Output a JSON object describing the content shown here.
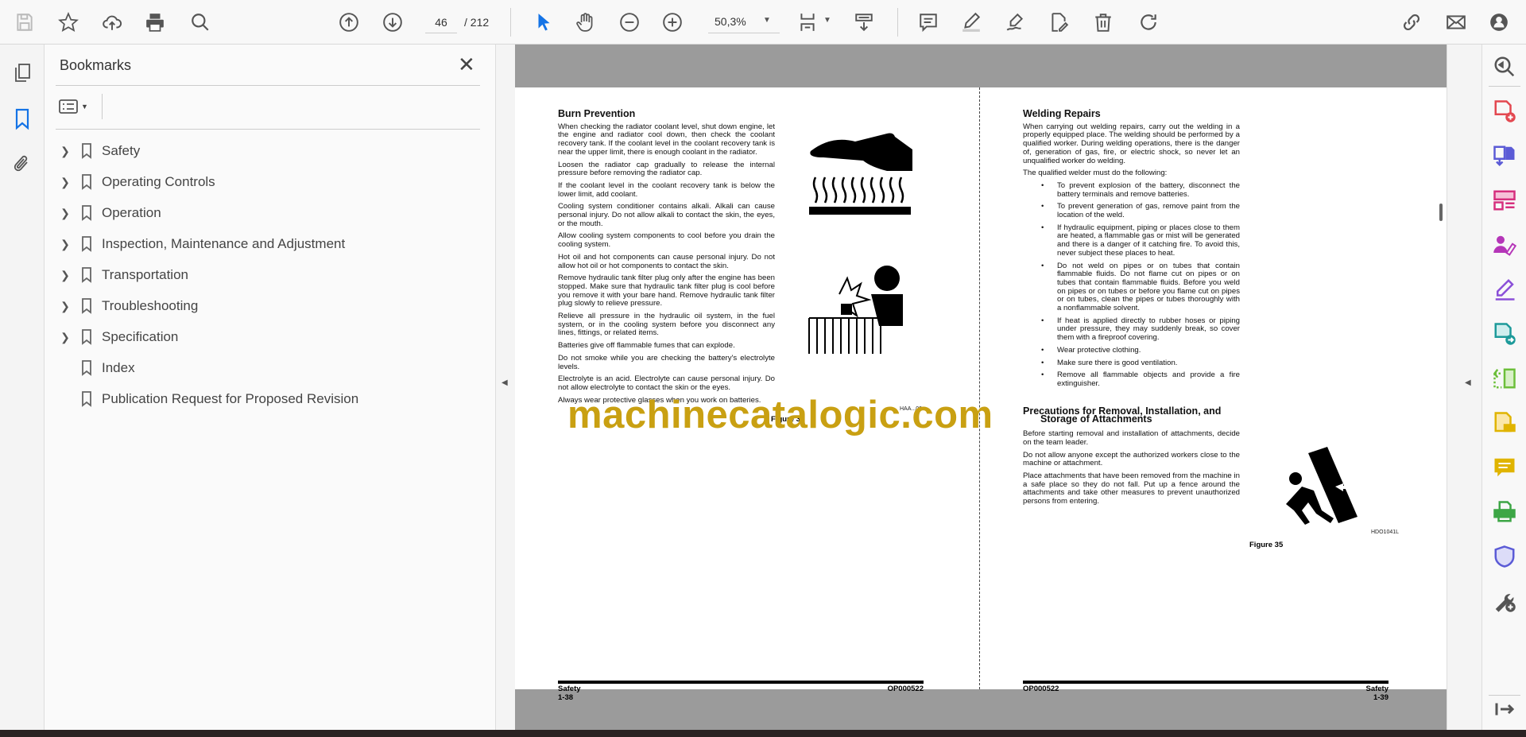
{
  "toolbar": {
    "page_current": "46",
    "page_total": "/ 212",
    "zoom": "50,3%",
    "icons": [
      "save-icon",
      "bookmark-star-icon",
      "upload-icon",
      "print-icon",
      "find-icon",
      "prev-page-icon",
      "next-page-icon",
      "select-cursor-icon",
      "hand-icon",
      "zoom-out-icon",
      "zoom-in-icon",
      "fit-page-icon",
      "scroll-mode-icon",
      "comment-icon",
      "highlight-icon",
      "sign-icon",
      "edit-icon",
      "trash-icon",
      "rotate-icon",
      "share-link-icon",
      "mail-icon",
      "account-icon"
    ]
  },
  "bookmarks": {
    "title": "Bookmarks",
    "items": [
      {
        "label": "Safety",
        "expandable": true
      },
      {
        "label": "Operating Controls",
        "expandable": true
      },
      {
        "label": "Operation",
        "expandable": true
      },
      {
        "label": "Inspection, Maintenance and Adjustment",
        "expandable": true
      },
      {
        "label": "Transportation",
        "expandable": true
      },
      {
        "label": "Troubleshooting",
        "expandable": true
      },
      {
        "label": "Specification",
        "expandable": true
      },
      {
        "label": "Index",
        "expandable": false
      },
      {
        "label": "Publication Request for Proposed Revision",
        "expandable": false
      }
    ]
  },
  "left_page": {
    "heading": "Burn Prevention",
    "paragraphs": [
      "When checking the radiator coolant level, shut down engine, let the engine and radiator cool down, then check the coolant recovery tank. If the coolant level in the coolant recovery tank is near the upper limit, there is enough coolant in the radiator.",
      "Loosen the radiator cap gradually to release the internal pressure before removing the radiator cap.",
      "If the coolant level in the coolant recovery tank is below the lower limit, add coolant.",
      "Cooling system conditioner contains alkali. Alkali can cause personal injury. Do not allow alkali to contact the skin, the eyes, or the mouth.",
      "Allow cooling system components to cool before you drain the cooling system.",
      "Hot oil and hot components can cause personal injury. Do not allow hot oil or hot components to contact the skin.",
      "Remove hydraulic tank filter plug only after the engine has been stopped. Make sure that hydraulic tank filter plug is cool before you remove it with your bare hand. Remove hydraulic tank filter plug slowly to relieve pressure.",
      "Relieve all pressure in the hydraulic oil system, in the fuel system, or in the cooling system before you disconnect any lines, fittings, or related items.",
      "Batteries give off flammable fumes that can explode.",
      "Do not smoke while you are checking the battery's electrolyte levels.",
      "Electrolyte is an acid. Electrolyte can cause personal injury. Do not allow electrolyte to contact the skin or the eyes.",
      "Always wear protective glasses when you work on batteries."
    ],
    "figure_label": "Figure 34",
    "footer_section": "Safety",
    "footer_page": "1-38",
    "footer_code": "OP000522"
  },
  "right_page": {
    "heading1": "Welding Repairs",
    "intro": "When carrying out welding repairs, carry out the welding in a properly equipped place. The welding should be performed by a qualified worker. During welding operations, there is the danger of, generation of gas, fire, or electric shock, so never let an unqualified worker do welding.",
    "lead": "The qualified welder must do the following:",
    "bullets": [
      "To prevent explosion of the battery, disconnect the battery terminals and remove batteries.",
      "To prevent generation of gas, remove paint from the location of the weld.",
      "If hydraulic equipment, piping or places close to them are heated, a flammable gas or mist will be generated and there is a danger of it catching fire. To avoid this, never subject these places to heat.",
      "Do not weld on pipes or on tubes that contain flammable fluids. Do not flame cut on pipes or on tubes that contain flammable fluids. Before you weld on pipes or on tubes or before you flame cut on pipes or on tubes, clean the pipes or tubes thoroughly with a nonflammable solvent.",
      "If heat is applied directly to rubber hoses or piping under pressure, they may suddenly break, so cover them with a fireproof covering.",
      "Wear protective clothing.",
      "Make sure there is good ventilation.",
      "Remove all flammable objects and provide a fire extinguisher."
    ],
    "heading2_line1": "Precautions for Removal, Installation, and",
    "heading2_line2": "Storage of Attachments",
    "paragraphs2": [
      "Before starting removal and installation of attachments, decide on the team leader.",
      "Do not allow anyone except the authorized workers close to the machine or attachment.",
      "Place attachments that have been removed from the machine in a safe place so they do not fall. Put up a fence around the attachments and take other measures to prevent unauthorized persons from entering."
    ],
    "figure_code": "HDO1041L",
    "figure_label": "Figure 35",
    "footer_section": "Safety",
    "footer_page": "1-39",
    "footer_code": "OP000522"
  },
  "watermark": "machinecatalogic.com",
  "colors": {
    "watermark": "#c9a012",
    "accent": "#1473e6",
    "doc_bg": "#9b9b9b"
  }
}
